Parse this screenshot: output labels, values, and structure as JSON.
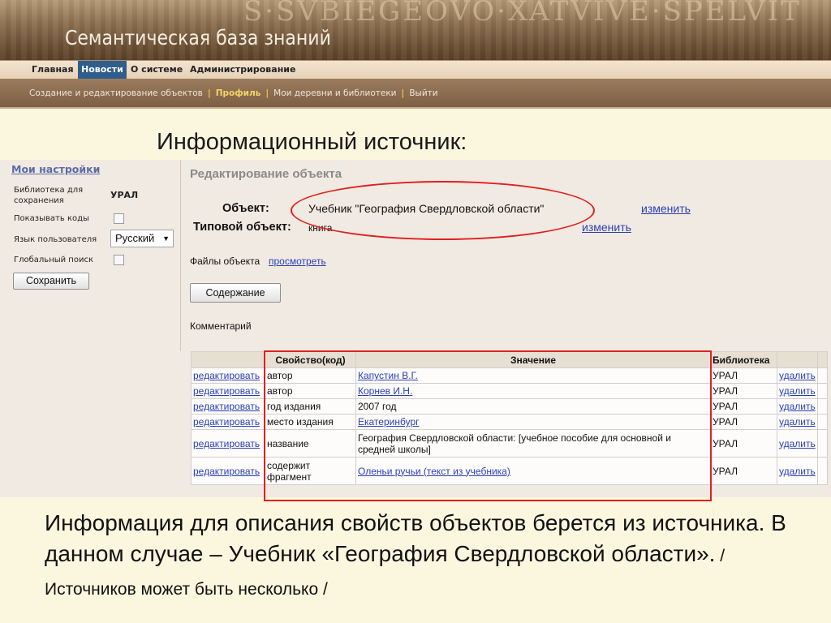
{
  "header": {
    "site_title": "Семантическая база знаний",
    "bg_inscription": "S·SVBIEGEOVO·XATVIVE·SPELVIT"
  },
  "main_nav": [
    {
      "label": "Главная",
      "active": false
    },
    {
      "label": "Новости",
      "active": true
    },
    {
      "label": "О системе",
      "active": false
    },
    {
      "label": "Администрирование",
      "active": false
    }
  ],
  "sub_nav": [
    {
      "label": "Создание и редактирование объектов",
      "active": false
    },
    {
      "label": "Профиль",
      "active": true
    },
    {
      "label": "Мои деревни и библиотеки",
      "active": false
    },
    {
      "label": "Выйти",
      "active": false
    }
  ],
  "slide_heading": "Информационный источник:",
  "sidebar": {
    "title": "Мои настройки",
    "library_label": "Библиотека для сохранения",
    "library_value": "УРАЛ",
    "show_codes_label": "Показывать коды",
    "language_label": "Язык пользователя",
    "language_value": "Русский",
    "global_search_label": "Глобальный поиск",
    "save_button": "Сохранить"
  },
  "editor": {
    "title": "Редактирование объекта",
    "object_label": "Объект:",
    "object_value": "Учебник \"География Свердловской области\"",
    "object_change": "изменить",
    "type_label": "Типовой объект:",
    "type_value": "книга",
    "type_change": "изменить",
    "files_label": "Файлы объекта",
    "files_link": "просмотреть",
    "contents_button": "Содержание",
    "comment_label": "Комментарий"
  },
  "table": {
    "headers": [
      "Свойство(код)",
      "Значение",
      "Библиотека"
    ],
    "edit_label": "редактировать",
    "delete_label": "удалить",
    "rows": [
      {
        "property": "автор",
        "value": "Капустин В.Г.",
        "value_is_link": true,
        "library": "УРАЛ"
      },
      {
        "property": "автор",
        "value": "Корнев И.Н.",
        "value_is_link": true,
        "library": "УРАЛ"
      },
      {
        "property": "год издания",
        "value": "2007 год",
        "value_is_link": false,
        "library": "УРАЛ"
      },
      {
        "property": "место издания",
        "value": "Екатеринбург",
        "value_is_link": true,
        "library": "УРАЛ"
      },
      {
        "property": "название",
        "value": "География Свердловской области: [учебное пособие для основной и средней школы]",
        "value_is_link": false,
        "library": "УРАЛ"
      },
      {
        "property": "содержит фрагмент",
        "value": "Оленьи ручьи (текст из учебника)",
        "value_is_link": true,
        "library": "УРАЛ"
      }
    ]
  },
  "caption": {
    "main": "Информация для описания свойств объектов берется из источника. В данном случае – Учебник «География Свердловской области».",
    "note": " / Источников может быть несколько /"
  },
  "colors": {
    "annotation_red": "#e02020",
    "link_blue": "#2a3fb7",
    "active_nav": "#2f5e8c",
    "slide_bg": "#fbf7df"
  }
}
